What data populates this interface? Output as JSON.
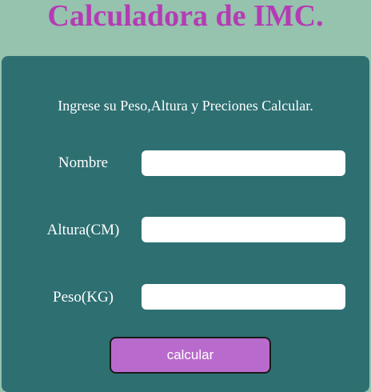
{
  "header": {
    "title": "Calculadora de IMC."
  },
  "form": {
    "instructions": "Ingrese su Peso,Altura y Preciones Calcular.",
    "fields": [
      {
        "label": "Nombre",
        "value": "",
        "placeholder": ""
      },
      {
        "label": "Altura(CM)",
        "value": "",
        "placeholder": ""
      },
      {
        "label": "Peso(KG)",
        "value": "",
        "placeholder": ""
      }
    ],
    "submit_label": "calcular"
  },
  "colors": {
    "background": "#96c3ad",
    "title": "#b53bb5",
    "panel": "#2e6f72",
    "button": "#b96bcd",
    "text": "#ffffff"
  }
}
